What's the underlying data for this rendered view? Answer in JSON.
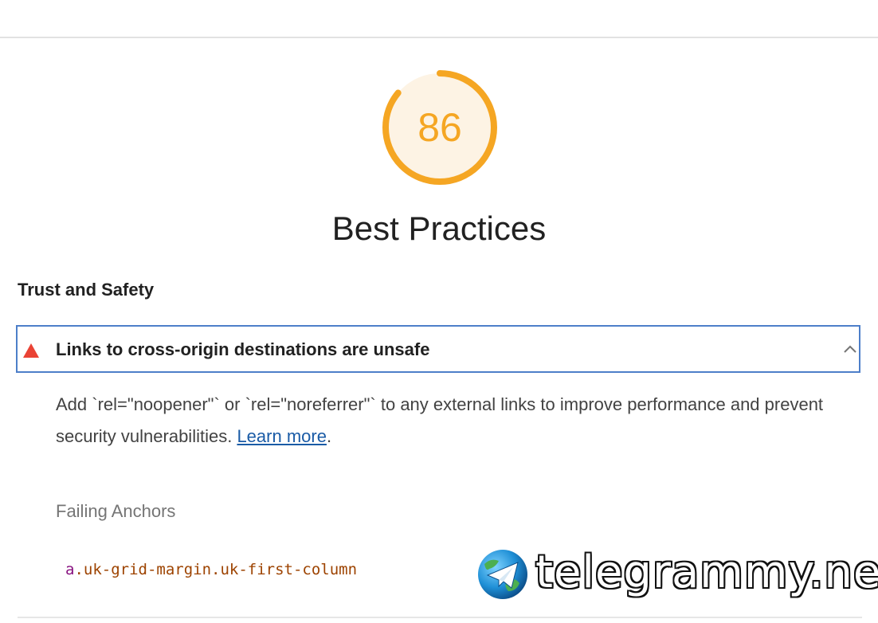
{
  "score": {
    "value": "86",
    "fraction": 0.86,
    "color": "#f5a623",
    "track_color": "#fdf3e4"
  },
  "category": {
    "title": "Best Practices"
  },
  "group": {
    "title": "Trust and Safety"
  },
  "audit": {
    "status": "fail",
    "status_color": "#ea4335",
    "title": "Links to cross-origin destinations are unsafe",
    "expanded": true,
    "description_text": "Add `rel=\"noopener\"` or `rel=\"noreferrer\"` to any external links to improve performance and prevent security vulnerabilities. ",
    "learn_more": "Learn more",
    "description_end": ".",
    "details_heading": "Failing Anchors",
    "anchors": [
      {
        "tag": "a",
        "selector": ".uk-grid-margin.uk-first-column"
      }
    ]
  },
  "watermark": {
    "text": "telegrammy.net",
    "icon": "telegram-globe-icon"
  }
}
